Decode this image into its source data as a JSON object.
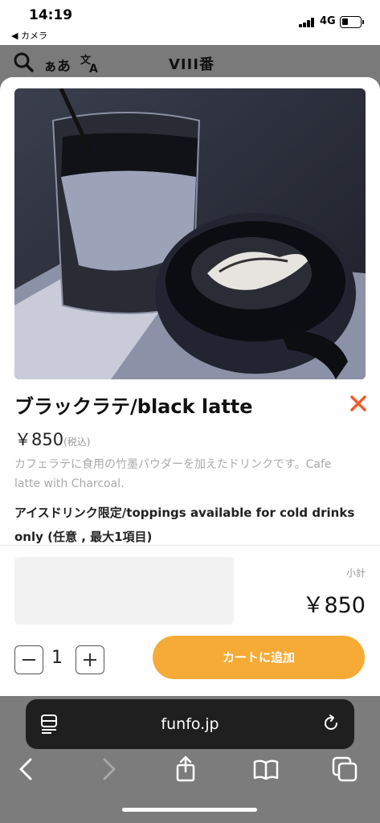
{
  "status_bar": {
    "time": "14:19",
    "back_app": "◀ カメラ",
    "network": "4G"
  },
  "header": {
    "search_icon": "search-icon",
    "language_label": "ぁあ",
    "translate_icon": "translate-icon",
    "store_name": "VIII番"
  },
  "product": {
    "title": "ブラックラテ/black latte",
    "price": "￥850",
    "tax_note": "(税込)",
    "description": "カフェラテに食用の竹墨パウダーを加えたドリンクです。Cafe latte with Charcoal.",
    "topping_note": "アイスドリンク限定/toppings available for cold drinks only (任意 , 最大1項目)"
  },
  "order": {
    "subtotal_label": "小計",
    "subtotal_value": "￥850",
    "quantity": "1",
    "add_to_cart_label": "カートに追加"
  },
  "browser": {
    "url": "funfo.jp"
  },
  "colors": {
    "accent": "#f6ab36",
    "close": "#f05a2a"
  }
}
